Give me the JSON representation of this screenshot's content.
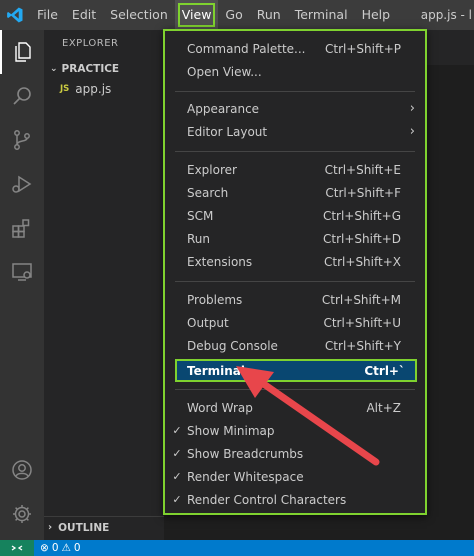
{
  "window": {
    "title": "app.js - l"
  },
  "menubar": {
    "items": [
      {
        "label": "File"
      },
      {
        "label": "Edit"
      },
      {
        "label": "Selection"
      },
      {
        "label": "View"
      },
      {
        "label": "Go"
      },
      {
        "label": "Run"
      },
      {
        "label": "Terminal"
      },
      {
        "label": "Help"
      }
    ],
    "active": "View"
  },
  "activitybar": {
    "icons": [
      "explorer-icon",
      "search-icon",
      "source-control-icon",
      "run-debug-icon",
      "extensions-icon",
      "remote-explorer-icon",
      "account-icon",
      "manage-gear-icon"
    ]
  },
  "sidebar": {
    "title": "EXPLORER",
    "folder": "PRACTICE",
    "files": [
      {
        "badge": "JS",
        "name": "app.js"
      }
    ],
    "outline_label": "OUTLINE"
  },
  "view_menu": {
    "groups": [
      [
        {
          "label": "Command Palette...",
          "shortcut": "Ctrl+Shift+P"
        },
        {
          "label": "Open View...",
          "shortcut": ""
        }
      ],
      [
        {
          "label": "Appearance",
          "shortcut": "",
          "submenu": true
        },
        {
          "label": "Editor Layout",
          "shortcut": "",
          "submenu": true
        }
      ],
      [
        {
          "label": "Explorer",
          "shortcut": "Ctrl+Shift+E"
        },
        {
          "label": "Search",
          "shortcut": "Ctrl+Shift+F"
        },
        {
          "label": "SCM",
          "shortcut": "Ctrl+Shift+G"
        },
        {
          "label": "Run",
          "shortcut": "Ctrl+Shift+D"
        },
        {
          "label": "Extensions",
          "shortcut": "Ctrl+Shift+X"
        }
      ],
      [
        {
          "label": "Problems",
          "shortcut": "Ctrl+Shift+M"
        },
        {
          "label": "Output",
          "shortcut": "Ctrl+Shift+U"
        },
        {
          "label": "Debug Console",
          "shortcut": "Ctrl+Shift+Y"
        },
        {
          "label": "Terminal",
          "shortcut": "Ctrl+`",
          "highlighted": true
        }
      ],
      [
        {
          "label": "Word Wrap",
          "shortcut": "Alt+Z"
        },
        {
          "label": "Show Minimap",
          "shortcut": "",
          "checked": true
        },
        {
          "label": "Show Breadcrumbs",
          "shortcut": "",
          "checked": true
        },
        {
          "label": "Render Whitespace",
          "shortcut": "",
          "checked": true
        },
        {
          "label": "Render Control Characters",
          "shortcut": "",
          "checked": true
        }
      ]
    ]
  },
  "statusbar": {
    "errors": "0",
    "warnings": "0"
  },
  "colors": {
    "annotation_green": "#7fd22f",
    "annotation_arrow": "#e8464b",
    "menu_highlight": "#094771",
    "statusbar": "#007acc"
  }
}
